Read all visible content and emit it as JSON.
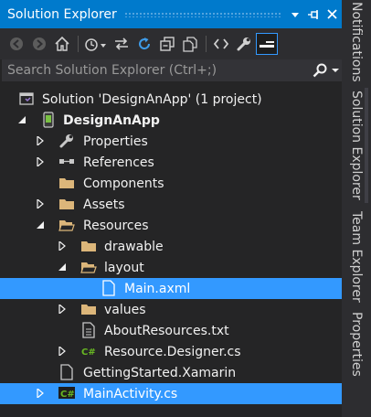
{
  "window": {
    "title": "Solution Explorer"
  },
  "search": {
    "placeholder": "Search Solution Explorer (Ctrl+;)"
  },
  "tree": {
    "solution": "Solution 'DesignAnApp' (1 project)",
    "project": "DesignAnApp",
    "items": [
      {
        "label": "Properties"
      },
      {
        "label": "References"
      },
      {
        "label": "Components"
      },
      {
        "label": "Assets"
      },
      {
        "label": "Resources"
      },
      {
        "label": "drawable"
      },
      {
        "label": "layout"
      },
      {
        "label": "Main.axml"
      },
      {
        "label": "values"
      },
      {
        "label": "AboutResources.txt"
      },
      {
        "label": "Resource.Designer.cs"
      },
      {
        "label": "GettingStarted.Xamarin"
      },
      {
        "label": "MainActivity.cs"
      }
    ]
  },
  "side_tabs": [
    "Notifications",
    "Solution Explorer",
    "Team Explorer",
    "Properties"
  ],
  "colors": {
    "accent": "#007acc",
    "selection": "#3399ff",
    "background": "#252526",
    "folder": "#dcb67a",
    "csharp": "#68b723"
  },
  "icons": [
    "back-icon",
    "forward-icon",
    "home-icon",
    "history-icon",
    "sync-icon",
    "refresh-icon",
    "collapse-all-icon",
    "show-all-files-icon",
    "view-code-icon",
    "properties-wrench-icon",
    "preview-icon",
    "search-icon"
  ]
}
